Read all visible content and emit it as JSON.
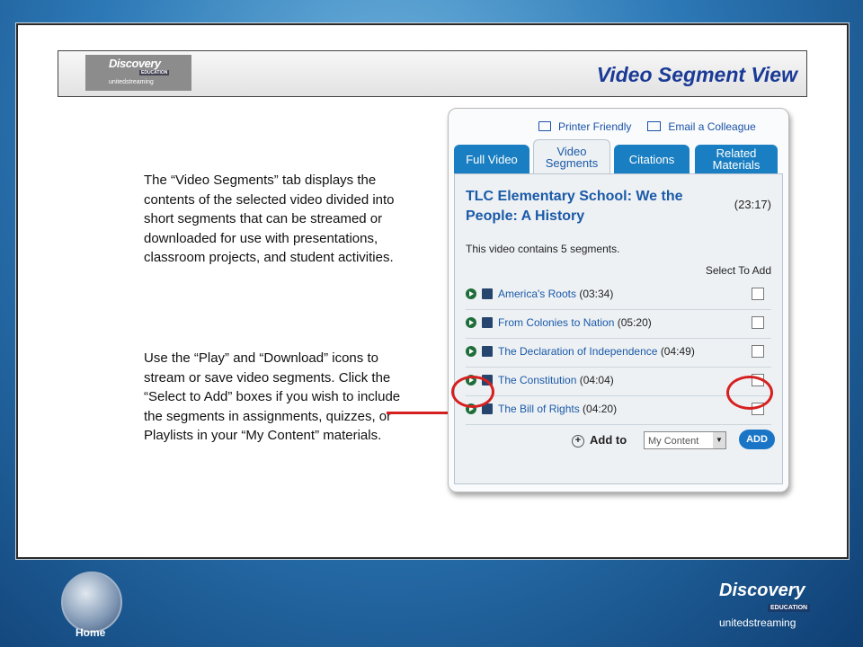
{
  "header": {
    "title": "Video Segment View",
    "logo": {
      "top": "Discovery",
      "middle": "EDUCATION",
      "bottom": "unitedstreaming"
    }
  },
  "body": {
    "paragraph_1": "The “Video Segments” tab displays the contents of the selected video divided into short segments that can be streamed or downloaded for use with presentations, classroom projects, and student activities.",
    "paragraph_2": "Use the “Play” and “Download” icons to stream or save video segments. Click the “Select to Add” boxes if you wish to include the segments in assignments, quizzes, or Playlists in your “My Content” materials."
  },
  "screenshot": {
    "printer_friendly": "Printer Friendly",
    "email_colleague": "Email a Colleague",
    "tabs": [
      {
        "label": "Full Video",
        "active": false
      },
      {
        "label": "Video Segments",
        "active": true
      },
      {
        "label": "Citations",
        "active": false
      },
      {
        "label": "Related Materials",
        "active": false
      }
    ],
    "video_title": "TLC Elementary School: We the People: A History",
    "video_duration": "(23:17)",
    "segment_count_text": "This video contains 5 segments.",
    "select_to_add_label": "Select To Add",
    "segments": [
      {
        "name": "America's Roots",
        "duration": "(03:34)"
      },
      {
        "name": "From Colonies to Nation",
        "duration": "(05:20)"
      },
      {
        "name": "The Declaration of Independence",
        "duration": "(04:49)"
      },
      {
        "name": "The Constitution",
        "duration": "(04:04)"
      },
      {
        "name": "The Bill of Rights",
        "duration": "(04:20)"
      }
    ],
    "add_to_label": "Add to",
    "add_to_selected": "My Content",
    "add_button": "ADD"
  },
  "footer": {
    "home_label": "Home",
    "logo": {
      "top": "Discovery",
      "middle": "EDUCATION",
      "bottom": "unitedstreaming"
    }
  },
  "colors": {
    "accent_red": "#d62020",
    "title_blue": "#1a3a96",
    "tab_blue": "#1a7fc2"
  }
}
